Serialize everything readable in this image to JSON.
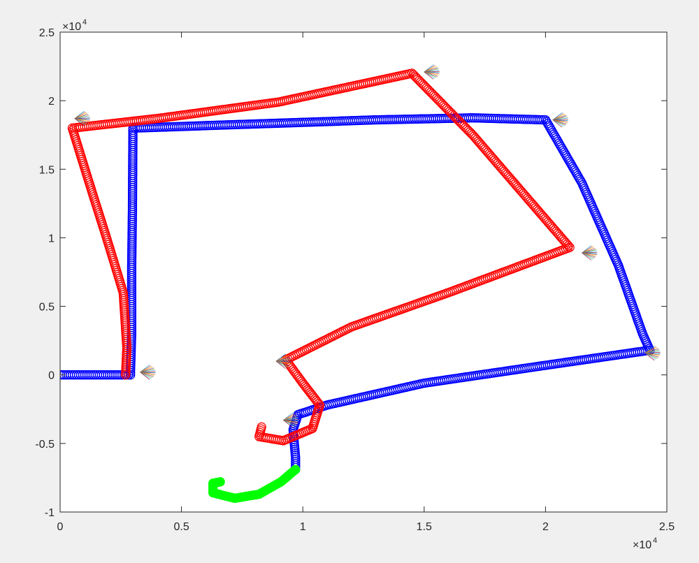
{
  "chart_data": {
    "type": "scatter",
    "title": "",
    "xlabel": "",
    "ylabel": "",
    "xlim": [
      0,
      25000
    ],
    "ylim": [
      -10000,
      25000
    ],
    "grid": false,
    "x_ticks": [
      0,
      5000,
      10000,
      15000,
      20000,
      25000
    ],
    "y_ticks": [
      -10000,
      -5000,
      0,
      5000,
      10000,
      15000,
      20000,
      25000
    ],
    "x_tick_labels": [
      "0",
      "0.5",
      "1",
      "1.5",
      "2",
      "2.5"
    ],
    "y_tick_labels": [
      "-1",
      "-0.5",
      "0",
      "0.5",
      "1",
      "1.5",
      "2",
      "2.5"
    ],
    "x_exponent_label": "×10",
    "x_exponent_power": "4",
    "y_exponent_label": "×10",
    "y_exponent_power": "4",
    "series": [
      {
        "color": "#0000ff",
        "marker": "circle-open",
        "points": [
          [
            0,
            0
          ],
          [
            2900,
            0
          ],
          [
            2900,
            300
          ],
          [
            2950,
            3000
          ],
          [
            2950,
            8000
          ],
          [
            2980,
            12000
          ],
          [
            3000,
            18000
          ],
          [
            8000,
            18300
          ],
          [
            13000,
            18600
          ],
          [
            17000,
            18750
          ],
          [
            20000,
            18600
          ],
          [
            21500,
            14000
          ],
          [
            23000,
            8000
          ],
          [
            24000,
            3000
          ],
          [
            24300,
            1800
          ],
          [
            20000,
            700
          ],
          [
            15000,
            -600
          ],
          [
            11000,
            -2200
          ],
          [
            9800,
            -2900
          ],
          [
            9600,
            -4000
          ],
          [
            9700,
            -6000
          ],
          [
            9700,
            -6900
          ]
        ]
      },
      {
        "color": "#ff0000",
        "marker": "circle-open",
        "points": [
          [
            2700,
            0
          ],
          [
            2750,
            2000
          ],
          [
            2600,
            6000
          ],
          [
            2000,
            9500
          ],
          [
            1200,
            14000
          ],
          [
            500,
            18000
          ],
          [
            4000,
            18700
          ],
          [
            9000,
            19900
          ],
          [
            14500,
            22000
          ],
          [
            17000,
            17500
          ],
          [
            21000,
            9300
          ],
          [
            16000,
            6000
          ],
          [
            12000,
            3500
          ],
          [
            9300,
            1100
          ],
          [
            10000,
            -600
          ],
          [
            10700,
            -2200
          ],
          [
            10400,
            -3900
          ],
          [
            9200,
            -4800
          ],
          [
            8200,
            -4500
          ],
          [
            8300,
            -3800
          ]
        ]
      },
      {
        "color": "#00ff00",
        "marker": "circle-filled",
        "points": [
          [
            9700,
            -6900
          ],
          [
            9100,
            -7800
          ],
          [
            8200,
            -8700
          ],
          [
            7200,
            -9000
          ],
          [
            6300,
            -8600
          ],
          [
            6300,
            -7900
          ],
          [
            6600,
            -7800
          ]
        ]
      }
    ],
    "fan_marks": [
      [
        3300,
        200
      ],
      [
        600,
        18700
      ],
      [
        15000,
        22100
      ],
      [
        20300,
        18600
      ],
      [
        21500,
        8900
      ],
      [
        24100,
        1600
      ],
      [
        8900,
        1000
      ],
      [
        9200,
        -3300
      ]
    ]
  }
}
